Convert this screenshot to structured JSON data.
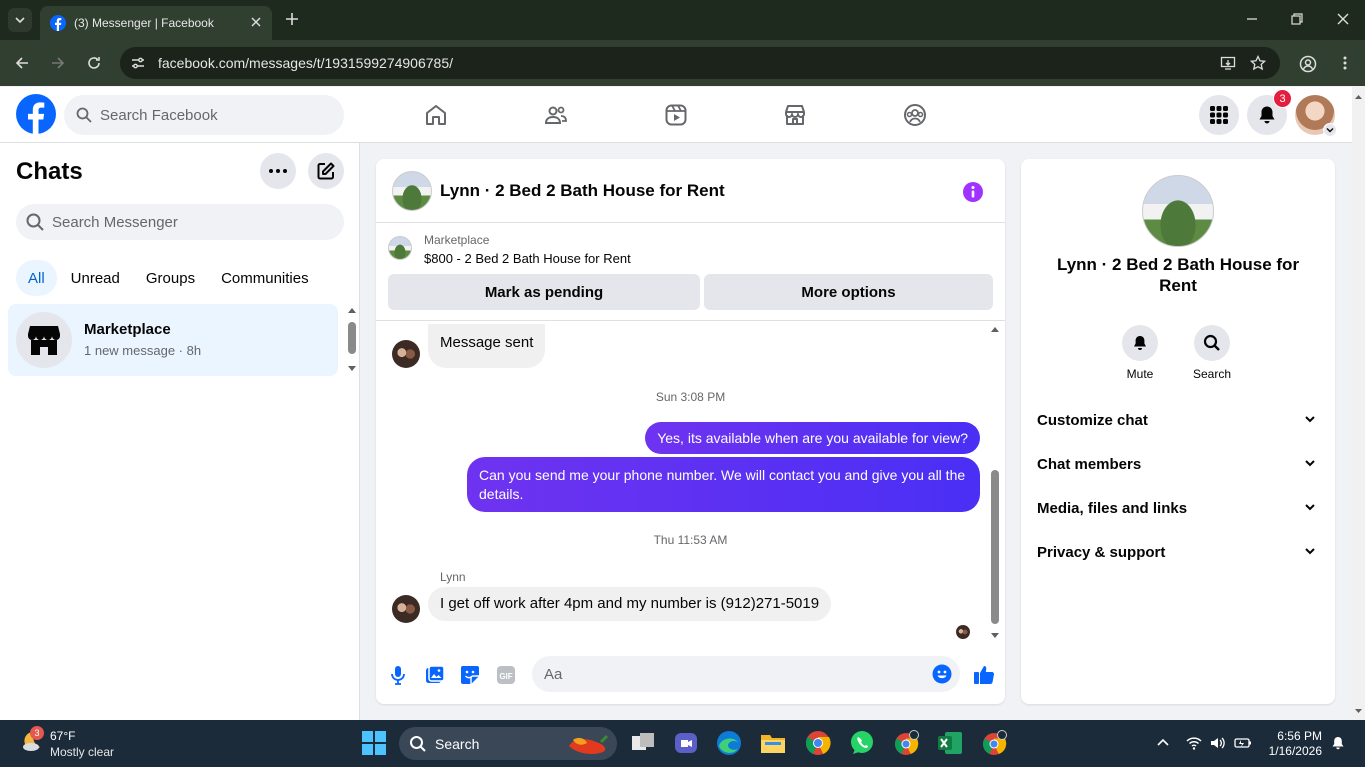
{
  "browser": {
    "tab_title": "(3) Messenger | Facebook",
    "url": "facebook.com/messages/t/1931599274906785/"
  },
  "header": {
    "search_placeholder": "Search Facebook",
    "notification_count": "3"
  },
  "sidebar": {
    "title": "Chats",
    "search_placeholder": "Search Messenger",
    "filters": [
      "All",
      "Unread",
      "Groups",
      "Communities"
    ],
    "chat": {
      "name": "Marketplace",
      "preview": "1 new message · 8h"
    }
  },
  "conversation": {
    "title": "Lynn · 2 Bed 2 Bath House for Rent",
    "marketplace_label": "Marketplace",
    "listing": "$800 - 2 Bed 2 Bath House for Rent",
    "mark_pending": "Mark as pending",
    "more_options": "More options",
    "messages": {
      "m1": "Message sent",
      "t1": "Sun 3:08 PM",
      "m2": "Yes, its available when are you available for view?",
      "m3": "Can you send me your phone number. We will contact you and give you all the details.",
      "t2": "Thu 11:53 AM",
      "sender": "Lynn",
      "m4": "I get off  work after 4pm and my number is (912)271-5019"
    },
    "composer_placeholder": "Aa"
  },
  "info_panel": {
    "name": "Lynn · 2 Bed 2 Bath House for Rent",
    "actions": {
      "mute": "Mute",
      "search": "Search"
    },
    "sections": [
      "Customize chat",
      "Chat members",
      "Media, files and links",
      "Privacy & support"
    ]
  },
  "taskbar": {
    "temp": "67°F",
    "weather": "Mostly clear",
    "weather_badge": "3",
    "search": "Search",
    "time": "6:56 PM",
    "date": "1/16/2026"
  },
  "colors": {
    "facebook_blue": "#0866ff",
    "outgoing_bubble": "#6f33f0",
    "accent_purple": "#a033ff"
  }
}
